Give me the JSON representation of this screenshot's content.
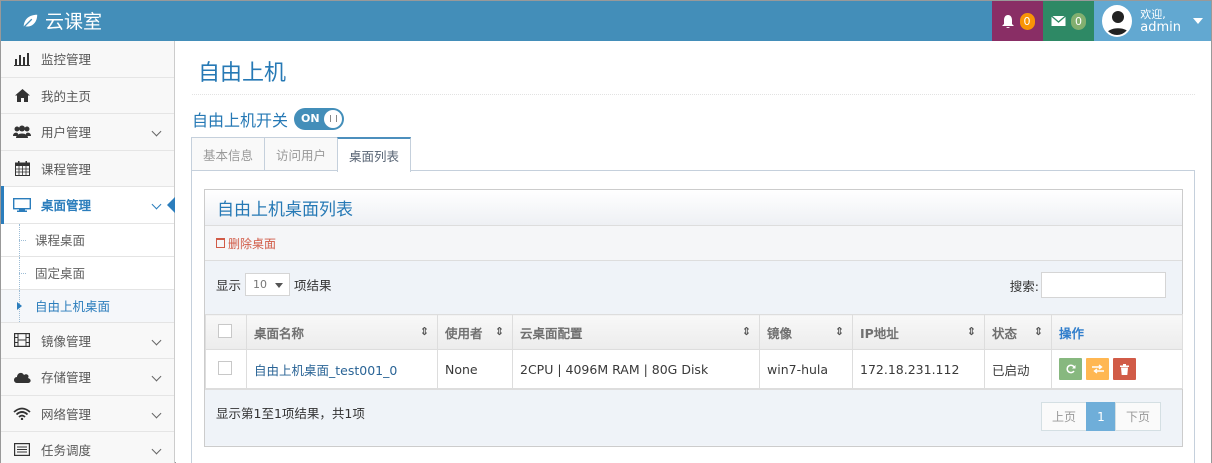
{
  "app": {
    "brand": "云课室"
  },
  "navbar": {
    "notifications_count": "0",
    "messages_count": "0",
    "welcome": "欢迎,",
    "username": "admin"
  },
  "sidebar": {
    "items": [
      {
        "label": "监控管理",
        "icon": "bar-chart-icon"
      },
      {
        "label": "我的主页",
        "icon": "home-icon"
      },
      {
        "label": "用户管理",
        "icon": "users-icon",
        "expandable": true
      },
      {
        "label": "课程管理",
        "icon": "calendar-icon"
      },
      {
        "label": "桌面管理",
        "icon": "desktop-icon",
        "expandable": true,
        "active": true
      },
      {
        "label": "镜像管理",
        "icon": "film-icon",
        "expandable": true
      },
      {
        "label": "存储管理",
        "icon": "cloud-icon",
        "expandable": true
      },
      {
        "label": "网络管理",
        "icon": "wifi-icon",
        "expandable": true
      },
      {
        "label": "任务调度",
        "icon": "list-icon",
        "expandable": true
      }
    ],
    "sub_items": [
      {
        "label": "课程桌面"
      },
      {
        "label": "固定桌面"
      },
      {
        "label": "自由上机桌面",
        "active": true
      }
    ]
  },
  "main": {
    "title": "自由上机",
    "switch_label": "自由上机开关",
    "switch_state": "ON",
    "tabs": [
      {
        "label": "基本信息"
      },
      {
        "label": "访问用户"
      },
      {
        "label": "桌面列表",
        "active": true
      }
    ],
    "widget": {
      "title": "自由上机桌面列表",
      "delete_label": "删除桌面",
      "length_prefix": "显示",
      "length_value": "10",
      "length_suffix": "项结果",
      "search_label": "搜索:",
      "columns": [
        "桌面名称",
        "使用者",
        "云桌面配置",
        "镜像",
        "IP地址",
        "状态",
        "操作"
      ],
      "rows": [
        {
          "name": "自由上机桌面_test001_0",
          "user": "None",
          "config": "2CPU | 4096M RAM | 80G Disk",
          "image": "win7-hula",
          "ip": "172.18.231.112",
          "status": "已启动"
        }
      ],
      "info": "显示第1至1项结果，共1项",
      "pager": {
        "prev": "上页",
        "current": "1",
        "next": "下页"
      }
    }
  },
  "colors": {
    "navbar": "#438eb9",
    "accent": "#2679b5",
    "bell_bg": "#892e65",
    "mail_bg": "#2e8965",
    "user_bg": "#62a8d1",
    "danger": "#d15b47"
  }
}
